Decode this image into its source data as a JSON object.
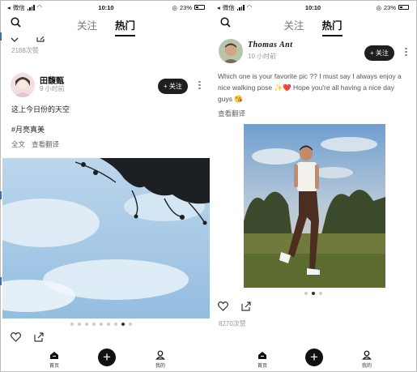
{
  "left": {
    "status": {
      "carrier": "微信",
      "time": "10:10",
      "battery": "23%"
    },
    "tabs": [
      "关注",
      "热门"
    ],
    "prev_views": "2188次赞",
    "post": {
      "username": "田馥甄",
      "time_ago": "9 小时前",
      "follow_label": "+ 关注",
      "caption": "这上今日份的天空",
      "tag": "#月亮真美",
      "links": [
        "全文",
        "查看翻译"
      ]
    },
    "pager": {
      "count": 9,
      "active": 7
    },
    "bottom": {
      "home_label": "首页",
      "me_label": "我的"
    }
  },
  "right": {
    "status": {
      "carrier": "微信",
      "time": "10:10",
      "battery": "23%"
    },
    "tabs": [
      "关注",
      "热门"
    ],
    "post": {
      "username": "Thomas Ant",
      "time_ago": "10 小时前",
      "follow_label": "+ 关注",
      "caption": "Which one is your favorite pic ?? I must say I always enjoy a nice walking pose ✨❤️ Hope you're all having a nice day guys 😘",
      "translate": "查看翻译",
      "views": "8270次赞"
    },
    "pager": {
      "count": 3,
      "active": 1
    },
    "bottom": {
      "home_label": "首页",
      "me_label": "我的"
    }
  }
}
